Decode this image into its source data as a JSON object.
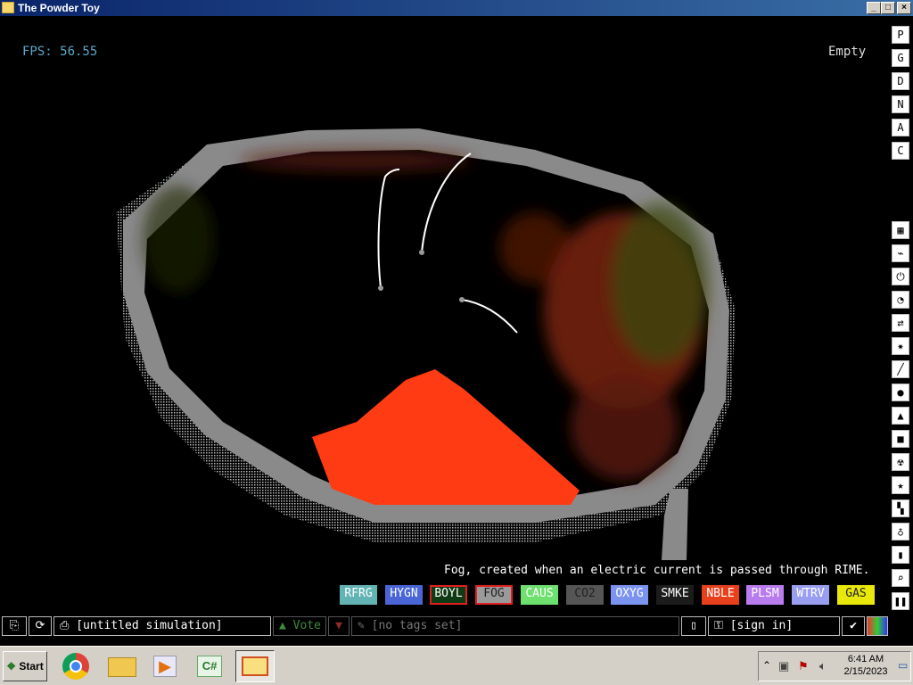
{
  "window": {
    "title": "The Powder Toy",
    "buttons": [
      "_",
      "□",
      "×"
    ]
  },
  "hud": {
    "fps": "FPS: 56.55",
    "hover_label": "Empty"
  },
  "side_menu_top": [
    "P",
    "G",
    "D",
    "N",
    "A",
    "C"
  ],
  "side_menu_categories": [
    "walls-icon",
    "electronics-icon",
    "powered-icon",
    "sensors-icon",
    "force-icon",
    "explosives-icon",
    "gases-icon",
    "liquids-icon",
    "powders-icon",
    "solids-icon",
    "radioactive-icon",
    "special-icon",
    "life-icon",
    "tools-icon",
    "favorites-icon",
    "search-icon"
  ],
  "description": "Fog, created when an electric current is passed through RIME.",
  "elements": [
    {
      "label": "RFRG",
      "color": "#62b4b4",
      "text": "#ffffff"
    },
    {
      "label": "HYGN",
      "color": "#4a66d6",
      "text": "#ffffff"
    },
    {
      "label": "BOYL",
      "color": "#0e3a14",
      "text": "#ffffff",
      "selected": true
    },
    {
      "label": "FOG",
      "color": "#9a9a9a",
      "text": "#222222",
      "selected": true
    },
    {
      "label": "CAUS",
      "color": "#6ee06e",
      "text": "#ffffff"
    },
    {
      "label": "CO2",
      "color": "#555555",
      "text": "#222222"
    },
    {
      "label": "OXYG",
      "color": "#7a94f0",
      "text": "#ffffff"
    },
    {
      "label": "SMKE",
      "color": "#1c1c1c",
      "text": "#ffffff"
    },
    {
      "label": "NBLE",
      "color": "#e8401c",
      "text": "#ffffff"
    },
    {
      "label": "PLSM",
      "color": "#b87cee",
      "text": "#ffffff"
    },
    {
      "label": "WTRV",
      "color": "#9a9ef0",
      "text": "#ffffff"
    },
    {
      "label": "GAS",
      "color": "#e8e80a",
      "text": "#222222"
    }
  ],
  "bottom_bar": {
    "simulation_name": "[untitled simulation]",
    "vote": "Vote",
    "tags": "[no tags set]",
    "sign_in": "[sign in]"
  },
  "taskbar": {
    "start": "Start",
    "apps": [
      "chrome-icon",
      "file-explorer-icon",
      "media-player-icon",
      "csharp-icon",
      "powder-toy-icon"
    ],
    "time": "6:41 AM",
    "date": "2/15/2023"
  },
  "colors": {
    "lava": "#ff3b14",
    "wall_gray": "#8a8a8a",
    "fps_blue": "#5ea6c8"
  }
}
